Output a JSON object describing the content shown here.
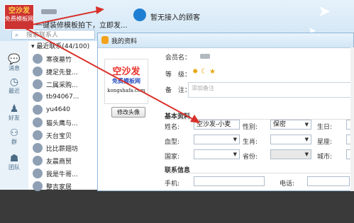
{
  "main_panel": {
    "avatar_line1": "空沙发",
    "avatar_line2": "免费模板网",
    "signature": "一键装修模板拍下，立即发...",
    "notice": "暂无接入的顾客",
    "search_placeholder": "搜索联系人"
  },
  "left_rail": [
    {
      "icon": "chat-bubble-icon",
      "label": "消息"
    },
    {
      "icon": "clock-icon",
      "label": "最近"
    },
    {
      "icon": "person-icon",
      "label": "好友"
    },
    {
      "icon": "group-icon",
      "label": "群"
    },
    {
      "icon": "team-icon",
      "label": "团队"
    }
  ],
  "contacts": {
    "header": "最近联系(44/100)",
    "items": [
      "寒夜墓竹",
      "捷足先登...",
      "二属采购...",
      "tb94067...",
      "yu4640",
      "猫头鹰与...",
      "天台宝贝",
      "比比薪翅坊",
      "友晨商贸",
      "我是牛哥...",
      "整吉家居"
    ]
  },
  "dialog": {
    "title": "我的资料",
    "logo_main": "空沙发",
    "logo_sub": "免费模板网",
    "logo_url": "kongshafa.com",
    "change_avatar_button": "修改头像",
    "member_label": "会员名：",
    "level_label": "等　级：",
    "remark_label": "备　注：",
    "remark_placeholder": "添加备注",
    "basic_section": "基本资料",
    "name_label": "姓名:",
    "name_value": "空沙发-小麦",
    "gender_label": "性别:",
    "gender_value": "保密",
    "birthday_label": "生日:",
    "blood_label": "血型:",
    "zodiac_label": "生肖:",
    "constellation_label": "星座:",
    "country_label": "国家:",
    "province_label": "省份:",
    "city_label": "城市:",
    "contact_section": "联系信息",
    "mobile_label": "手机:",
    "phone_label": "电话:"
  }
}
